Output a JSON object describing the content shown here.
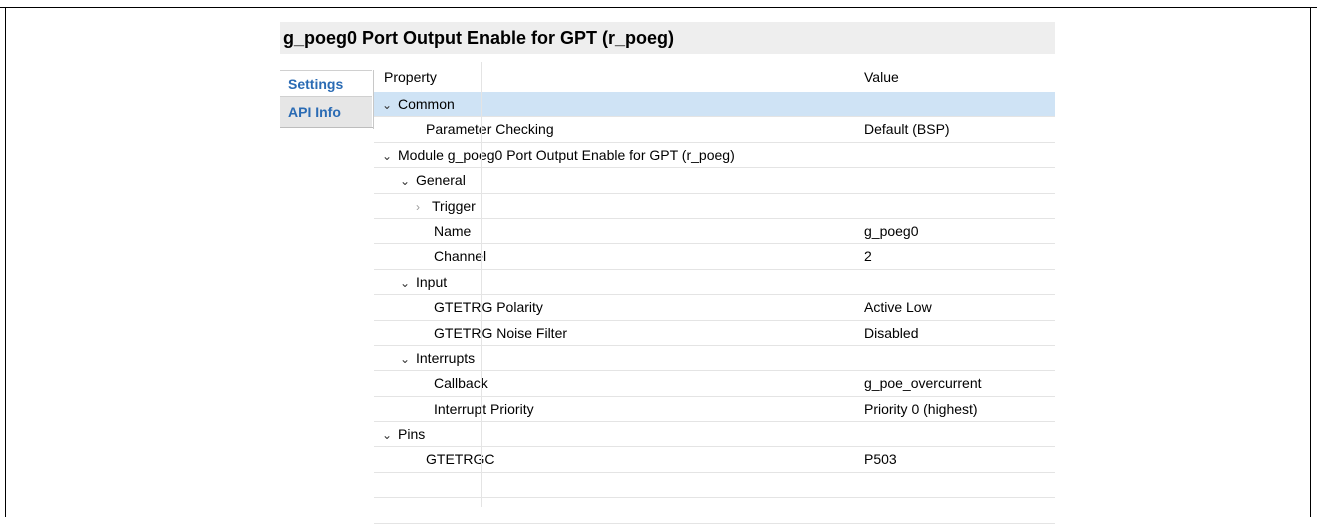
{
  "title": "g_poeg0 Port Output Enable for GPT (r_poeg)",
  "tabs": [
    {
      "label": "Settings"
    },
    {
      "label": "API Info"
    }
  ],
  "columns": {
    "property": "Property",
    "value": "Value"
  },
  "rows": [
    {
      "property": "Common",
      "value": "",
      "expander": "expanded",
      "selected": true
    },
    {
      "property": "Parameter Checking",
      "value": "Default (BSP)"
    },
    {
      "property": "Module g_poeg0 Port Output Enable for GPT (r_poeg)",
      "value": "",
      "expander": "expanded"
    },
    {
      "property": "General",
      "value": "",
      "expander": "expanded"
    },
    {
      "property": "Trigger",
      "value": "",
      "expander": "collapsed"
    },
    {
      "property": "Name",
      "value": "g_poeg0"
    },
    {
      "property": "Channel",
      "value": "2"
    },
    {
      "property": "Input",
      "value": "",
      "expander": "expanded"
    },
    {
      "property": "GTETRG Polarity",
      "value": "Active Low"
    },
    {
      "property": "GTETRG Noise Filter",
      "value": "Disabled"
    },
    {
      "property": "Interrupts",
      "value": "",
      "expander": "expanded"
    },
    {
      "property": "Callback",
      "value": "g_poe_overcurrent"
    },
    {
      "property": "Interrupt Priority",
      "value": "Priority 0 (highest)"
    },
    {
      "property": "Pins",
      "value": "",
      "expander": "expanded"
    },
    {
      "property": "GTETRGC",
      "value": "P503"
    },
    {
      "property": "",
      "value": ""
    },
    {
      "property": "",
      "value": ""
    }
  ]
}
